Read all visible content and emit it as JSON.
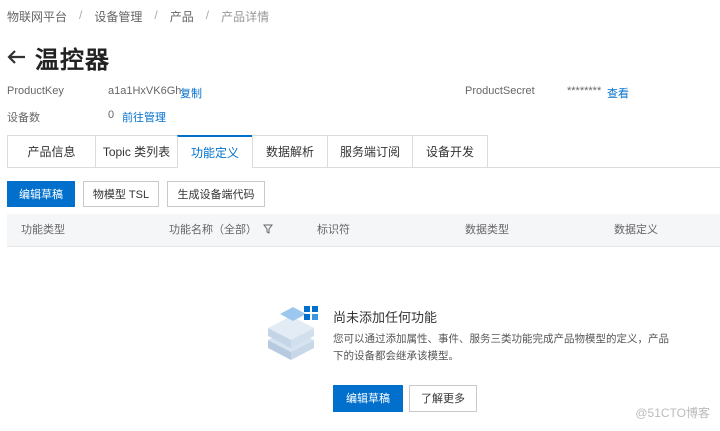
{
  "breadcrumb": [
    "物联网平台",
    "设备管理",
    "产品",
    "产品详情"
  ],
  "page": {
    "back_icon": "arrow-left-icon",
    "title": "温控器"
  },
  "product": {
    "key_label": "ProductKey",
    "key_value": "a1a1HxVK6Gh",
    "copy_label": "复制",
    "secret_label": "ProductSecret",
    "secret_value": "********",
    "view_label": "查看",
    "device_count_label": "设备数",
    "device_count_value": "0",
    "manage_label": "前往管理"
  },
  "tabs": [
    "产品信息",
    "Topic 类列表",
    "功能定义",
    "数据解析",
    "服务端订阅",
    "设备开发"
  ],
  "active_tab": "功能定义",
  "toolbar": {
    "edit_draft": "编辑草稿",
    "tsl": "物模型 TSL",
    "generate_code": "生成设备端代码"
  },
  "table": {
    "columns": [
      "功能类型",
      "功能名称（全部）",
      "标识符",
      "数据类型",
      "数据定义"
    ]
  },
  "empty": {
    "title": "尚未添加任何功能",
    "description": "您可以通过添加属性、事件、服务三类功能完成产品物模型的定义，产品下的设备都会继承该模型。",
    "primary_button": "编辑草稿",
    "secondary_button": "了解更多"
  },
  "watermark": "@51CTO博客",
  "colors": {
    "accent": "#0070cc",
    "header_bg": "#f5f6f8"
  }
}
